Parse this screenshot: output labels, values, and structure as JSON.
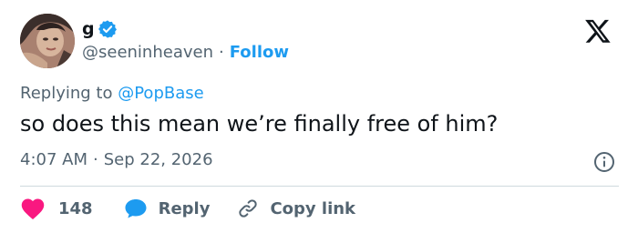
{
  "user": {
    "display_name": "g",
    "handle": "@seeninheaven",
    "separator": "·",
    "follow_label": "Follow"
  },
  "reply_context": {
    "prefix": "Replying to",
    "mention": "@PopBase"
  },
  "tweet": {
    "text": "so does this mean we’re finally free of him?",
    "time": "4:07 AM",
    "separator": "·",
    "date": "Sep 22, 2026"
  },
  "actions": {
    "likes_count": "148",
    "reply_label": "Reply",
    "copy_link_label": "Copy link"
  },
  "colors": {
    "accent": "#1d9bf0",
    "like": "#f91880",
    "text": "#0f1419",
    "muted": "#536471",
    "divider": "#cfd9de"
  },
  "icons": [
    "verified-badge-icon",
    "x-logo-icon",
    "info-icon",
    "heart-icon",
    "reply-bubble-icon",
    "link-icon"
  ]
}
